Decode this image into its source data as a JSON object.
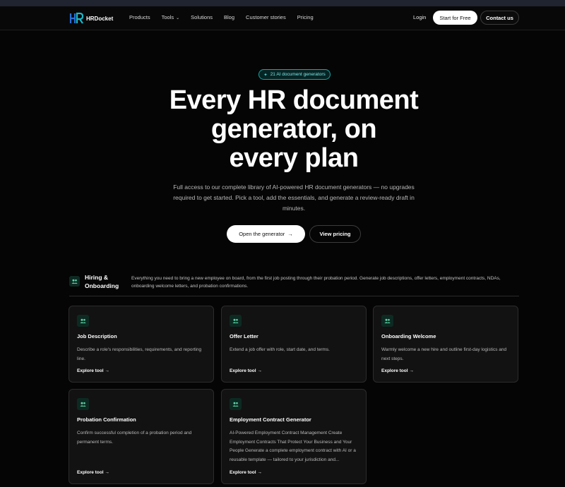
{
  "nav": {
    "brand": "HRDocket",
    "menu": [
      {
        "label": "Products"
      },
      {
        "label": "Tools",
        "has_dropdown": true
      },
      {
        "label": "Solutions"
      },
      {
        "label": "Blog"
      },
      {
        "label": "Customer stories"
      },
      {
        "label": "Pricing"
      }
    ],
    "login": "Login",
    "start_free": "Start for Free",
    "contact": "Contact us"
  },
  "hero": {
    "badge": "21 AI document generators",
    "title_line1": "Every HR document",
    "title_line2": "generator, on",
    "title_line3": "every plan",
    "description": "Full access to our complete library of AI-powered HR document generators — no upgrades required to get started. Pick a tool, add the essentials, and generate a review-ready draft in minutes.",
    "primary_cta": "Open the generator",
    "secondary_cta": "View pricing"
  },
  "section": {
    "title": "Hiring & Onboarding",
    "description": "Everything you need to bring a new employee on board, from the first job posting through their probation period. Generate job descriptions, offer letters, employment contracts, NDAs, onboarding welcome letters, and probation confirmations."
  },
  "cards": [
    {
      "title": "Job Description",
      "description": "Describe a role's responsibilities, requirements, and reporting line.",
      "link": "Explore tool"
    },
    {
      "title": "Offer Letter",
      "description": "Extend a job offer with role, start date, and terms.",
      "link": "Explore tool"
    },
    {
      "title": "Onboarding Welcome",
      "description": "Warmly welcome a new hire and outline first-day logistics and next steps.",
      "link": "Explore tool"
    },
    {
      "title": "Probation Confirmation",
      "description": "Confirm successful completion of a probation period and permanent terms.",
      "link": "Explore tool"
    },
    {
      "title": "Employment Contract Generator",
      "description": "AI-Powered Employment Contract Management Create Employment Contracts That Protect Your Business and Your People Generate a complete employment contract with AI or a reusable template — tailored to your jurisdiction and...",
      "link": "Explore tool"
    }
  ],
  "icons": {
    "arrow": "→",
    "sparkle": "✦",
    "chevron": "⌄",
    "people": "people-icon"
  },
  "colors": {
    "accent": "#14a6a6",
    "icon_bg": "#0d2a22",
    "icon_fg": "#5fd3a8",
    "page_bg": "#050505",
    "card_bg": "#121212"
  }
}
